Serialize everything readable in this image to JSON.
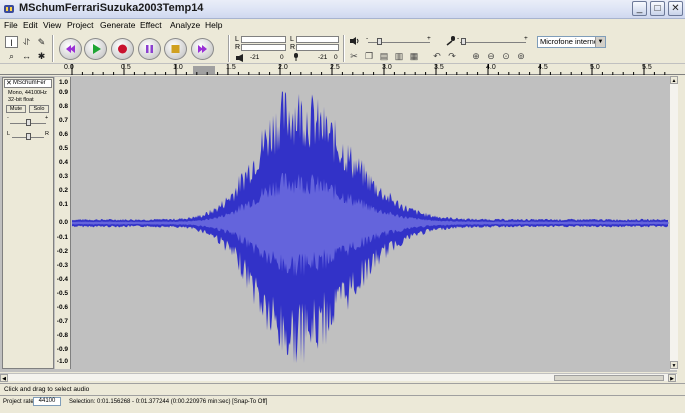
{
  "window": {
    "title": "MSchumFerrariSuzuka2003Temp14"
  },
  "titlebar_buttons": {
    "minimize": "_",
    "maximize": "□",
    "close": "✕"
  },
  "menu": [
    "File",
    "Edit",
    "View",
    "Project",
    "Generate",
    "Effect",
    "Analyze",
    "Help"
  ],
  "tools": {
    "selection": "I",
    "envelope": "⥯",
    "draw": "✎",
    "zoom": "⌕",
    "timeshift": "↔",
    "multi": "✱",
    "icons": [
      "cursor-icon",
      "envelope-icon",
      "pencil-icon",
      "magnifier-icon",
      "timeshift-icon",
      "multi-tool-icon"
    ]
  },
  "transport": {
    "icons": [
      "skip-to-start-icon",
      "play-icon",
      "record-icon",
      "pause-icon",
      "stop-icon",
      "skip-to-end-icon"
    ],
    "colors": {
      "skip": "#9a2fd6",
      "play": "#1ea534",
      "record": "#c8102e",
      "pause": "#8b3fd0",
      "stop": "#d0a020"
    }
  },
  "meters": {
    "playback": {
      "l": "L",
      "r": "R",
      "scale_min": "-21",
      "scale_zero": "0"
    },
    "record": {
      "l": "L",
      "r": "R",
      "scale_min": "-21",
      "scale_zero": "0"
    }
  },
  "mixer": {
    "vol_minus": "-",
    "vol_plus": "+",
    "in_minus": "-",
    "in_plus": "+"
  },
  "device": {
    "value": "Microfone interno"
  },
  "ruler": {
    "ticks": [
      "0.0",
      "0.5",
      "1.0",
      "1.5",
      "2.0",
      "2.5",
      "3.0",
      "3.5",
      "4.0",
      "4.5",
      "5.0",
      "5.5"
    ]
  },
  "track": {
    "name": "MSchumFer",
    "format": "Mono, 44100Hz",
    "bits": "32-bit float",
    "mute": "Mute",
    "solo": "Solo",
    "gain_minus": "-",
    "gain_plus": "+",
    "pan_left": "L",
    "pan_right": "R",
    "yticks": [
      "1.0",
      "0.9",
      "0.8",
      "0.7",
      "0.6",
      "0.5",
      "0.4",
      "0.3",
      "0.2",
      "0.1",
      "0.0",
      "-0.1",
      "-0.2",
      "-0.3",
      "-0.4",
      "-0.5",
      "-0.6",
      "-0.7",
      "-0.8",
      "-0.9",
      "-1.0"
    ],
    "wave_color": "#3232c8",
    "wave_color_rms": "#6464dc"
  },
  "status": {
    "hint": "Click and drag to select audio",
    "rate_label": "Project rate:",
    "rate_value": "44100",
    "selection": "Selection: 0:01.156268 - 0:01.377244 (0:00.220976 min:sec)  [Snap-To Off]"
  }
}
